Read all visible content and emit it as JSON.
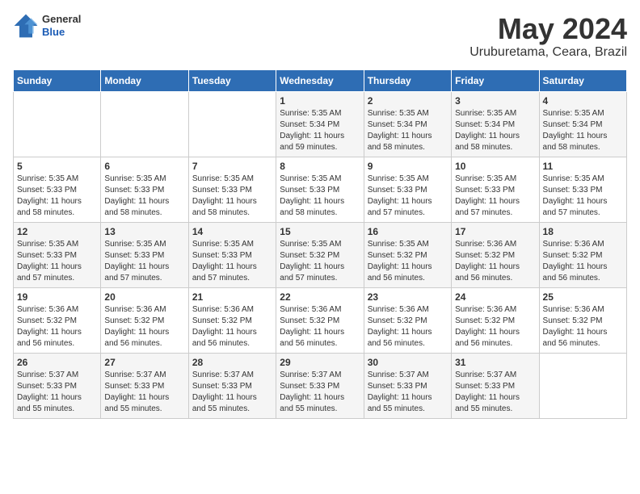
{
  "header": {
    "logo_general": "General",
    "logo_blue": "Blue",
    "month_title": "May 2024",
    "location": "Uruburetama, Ceara, Brazil"
  },
  "days_of_week": [
    "Sunday",
    "Monday",
    "Tuesday",
    "Wednesday",
    "Thursday",
    "Friday",
    "Saturday"
  ],
  "weeks": [
    [
      {
        "day": "",
        "info": ""
      },
      {
        "day": "",
        "info": ""
      },
      {
        "day": "",
        "info": ""
      },
      {
        "day": "1",
        "info": "Sunrise: 5:35 AM\nSunset: 5:34 PM\nDaylight: 11 hours\nand 59 minutes."
      },
      {
        "day": "2",
        "info": "Sunrise: 5:35 AM\nSunset: 5:34 PM\nDaylight: 11 hours\nand 58 minutes."
      },
      {
        "day": "3",
        "info": "Sunrise: 5:35 AM\nSunset: 5:34 PM\nDaylight: 11 hours\nand 58 minutes."
      },
      {
        "day": "4",
        "info": "Sunrise: 5:35 AM\nSunset: 5:34 PM\nDaylight: 11 hours\nand 58 minutes."
      }
    ],
    [
      {
        "day": "5",
        "info": "Sunrise: 5:35 AM\nSunset: 5:33 PM\nDaylight: 11 hours\nand 58 minutes."
      },
      {
        "day": "6",
        "info": "Sunrise: 5:35 AM\nSunset: 5:33 PM\nDaylight: 11 hours\nand 58 minutes."
      },
      {
        "day": "7",
        "info": "Sunrise: 5:35 AM\nSunset: 5:33 PM\nDaylight: 11 hours\nand 58 minutes."
      },
      {
        "day": "8",
        "info": "Sunrise: 5:35 AM\nSunset: 5:33 PM\nDaylight: 11 hours\nand 58 minutes."
      },
      {
        "day": "9",
        "info": "Sunrise: 5:35 AM\nSunset: 5:33 PM\nDaylight: 11 hours\nand 57 minutes."
      },
      {
        "day": "10",
        "info": "Sunrise: 5:35 AM\nSunset: 5:33 PM\nDaylight: 11 hours\nand 57 minutes."
      },
      {
        "day": "11",
        "info": "Sunrise: 5:35 AM\nSunset: 5:33 PM\nDaylight: 11 hours\nand 57 minutes."
      }
    ],
    [
      {
        "day": "12",
        "info": "Sunrise: 5:35 AM\nSunset: 5:33 PM\nDaylight: 11 hours\nand 57 minutes."
      },
      {
        "day": "13",
        "info": "Sunrise: 5:35 AM\nSunset: 5:33 PM\nDaylight: 11 hours\nand 57 minutes."
      },
      {
        "day": "14",
        "info": "Sunrise: 5:35 AM\nSunset: 5:33 PM\nDaylight: 11 hours\nand 57 minutes."
      },
      {
        "day": "15",
        "info": "Sunrise: 5:35 AM\nSunset: 5:32 PM\nDaylight: 11 hours\nand 57 minutes."
      },
      {
        "day": "16",
        "info": "Sunrise: 5:35 AM\nSunset: 5:32 PM\nDaylight: 11 hours\nand 56 minutes."
      },
      {
        "day": "17",
        "info": "Sunrise: 5:36 AM\nSunset: 5:32 PM\nDaylight: 11 hours\nand 56 minutes."
      },
      {
        "day": "18",
        "info": "Sunrise: 5:36 AM\nSunset: 5:32 PM\nDaylight: 11 hours\nand 56 minutes."
      }
    ],
    [
      {
        "day": "19",
        "info": "Sunrise: 5:36 AM\nSunset: 5:32 PM\nDaylight: 11 hours\nand 56 minutes."
      },
      {
        "day": "20",
        "info": "Sunrise: 5:36 AM\nSunset: 5:32 PM\nDaylight: 11 hours\nand 56 minutes."
      },
      {
        "day": "21",
        "info": "Sunrise: 5:36 AM\nSunset: 5:32 PM\nDaylight: 11 hours\nand 56 minutes."
      },
      {
        "day": "22",
        "info": "Sunrise: 5:36 AM\nSunset: 5:32 PM\nDaylight: 11 hours\nand 56 minutes."
      },
      {
        "day": "23",
        "info": "Sunrise: 5:36 AM\nSunset: 5:32 PM\nDaylight: 11 hours\nand 56 minutes."
      },
      {
        "day": "24",
        "info": "Sunrise: 5:36 AM\nSunset: 5:32 PM\nDaylight: 11 hours\nand 56 minutes."
      },
      {
        "day": "25",
        "info": "Sunrise: 5:36 AM\nSunset: 5:32 PM\nDaylight: 11 hours\nand 56 minutes."
      }
    ],
    [
      {
        "day": "26",
        "info": "Sunrise: 5:37 AM\nSunset: 5:33 PM\nDaylight: 11 hours\nand 55 minutes."
      },
      {
        "day": "27",
        "info": "Sunrise: 5:37 AM\nSunset: 5:33 PM\nDaylight: 11 hours\nand 55 minutes."
      },
      {
        "day": "28",
        "info": "Sunrise: 5:37 AM\nSunset: 5:33 PM\nDaylight: 11 hours\nand 55 minutes."
      },
      {
        "day": "29",
        "info": "Sunrise: 5:37 AM\nSunset: 5:33 PM\nDaylight: 11 hours\nand 55 minutes."
      },
      {
        "day": "30",
        "info": "Sunrise: 5:37 AM\nSunset: 5:33 PM\nDaylight: 11 hours\nand 55 minutes."
      },
      {
        "day": "31",
        "info": "Sunrise: 5:37 AM\nSunset: 5:33 PM\nDaylight: 11 hours\nand 55 minutes."
      },
      {
        "day": "",
        "info": ""
      }
    ]
  ]
}
